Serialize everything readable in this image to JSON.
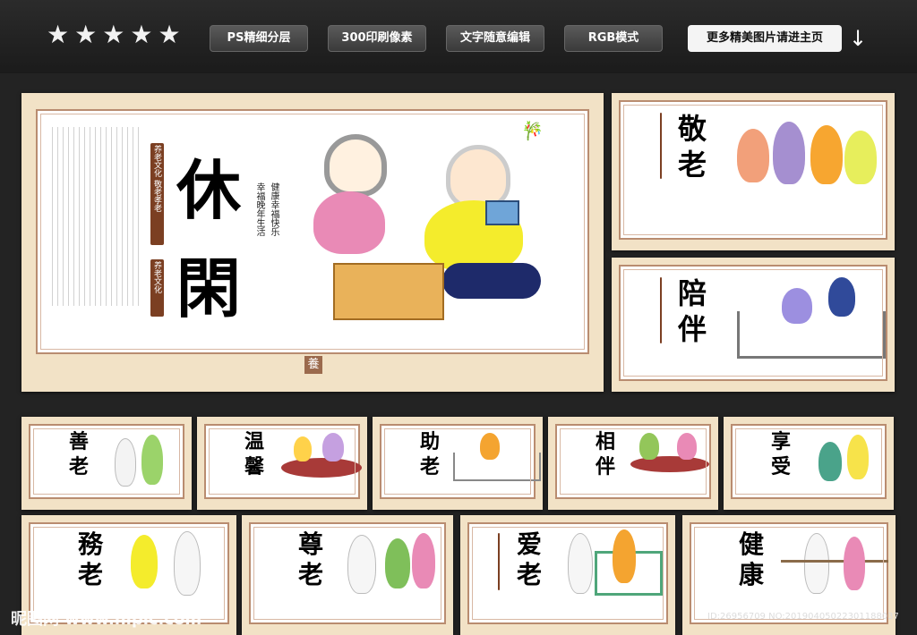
{
  "header": {
    "stars": [
      "★",
      "★",
      "★",
      "★",
      "★"
    ],
    "pills": [
      "PS精细分层",
      "300印刷像素",
      "文字随意编辑",
      "RGB模式"
    ],
    "more_link": "更多精美图片请进主页",
    "download_icon": "↓"
  },
  "main_board": {
    "title_chars": [
      "休",
      "閑"
    ],
    "tag1": "养老文化 敬老孝老",
    "tag2": "养老文化",
    "slogan1": "幸福晚年生活",
    "slogan2": "健康幸福快乐",
    "footer_char": "養"
  },
  "side_boards": [
    {
      "title": [
        "敬",
        "老"
      ]
    },
    {
      "title": [
        "陪",
        "伴"
      ]
    }
  ],
  "row1": [
    {
      "title": [
        "善",
        "老"
      ]
    },
    {
      "title": [
        "温",
        "馨"
      ]
    },
    {
      "title": [
        "助",
        "老"
      ]
    },
    {
      "title": [
        "相",
        "伴"
      ]
    },
    {
      "title": [
        "享",
        "受"
      ]
    }
  ],
  "row2": [
    {
      "title": [
        "務",
        "老"
      ]
    },
    {
      "title": [
        "尊",
        "老"
      ]
    },
    {
      "title": [
        "爱",
        "老"
      ]
    },
    {
      "title": [
        "健",
        "康"
      ]
    }
  ],
  "footer": {
    "watermark": "昵图网 www.nipic.com",
    "image_id": "ID:26956709 NO:20190405022301188037"
  },
  "colors": {
    "board": "#f2e2c6",
    "frame": "#b98c70",
    "accent": "#7b3f22"
  }
}
